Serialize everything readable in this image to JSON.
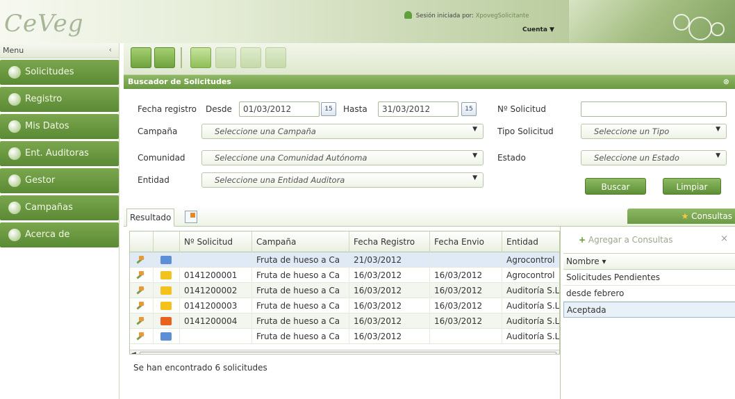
{
  "app": {
    "logo_text": "CeVeg",
    "session_label": "Sesión iniciada por:",
    "session_user": "XpovegSolicitante",
    "account_label": "Cuenta ▼"
  },
  "sidebar": {
    "title": "Menu",
    "collapse": "‹",
    "items": [
      {
        "label": "Solicitudes"
      },
      {
        "label": "Registro"
      },
      {
        "label": "Mis Datos"
      },
      {
        "label": "Ent. Auditoras"
      },
      {
        "label": "Gestor"
      },
      {
        "label": "Campañas"
      },
      {
        "label": "Acerca de"
      }
    ]
  },
  "search": {
    "title": "Buscador de Solicitudes",
    "collapse": "⊗",
    "fecha_registro_label": "Fecha registro",
    "desde_label": "Desde",
    "desde_value": "01/03/2012",
    "hasta_label": "Hasta",
    "hasta_value": "31/03/2012",
    "cal_label": "15",
    "campana_label": "Campaña",
    "campana_placeholder": "Seleccione una Campaña",
    "comunidad_label": "Comunidad",
    "comunidad_placeholder": "Seleccione una Comunidad Autónoma",
    "entidad_label": "Entidad",
    "entidad_placeholder": "Seleccione una Entidad Auditora",
    "nsolicitud_label": "Nº Solicitud",
    "nsolicitud_value": "",
    "tipo_label": "Tipo Solicitud",
    "tipo_placeholder": "Seleccione un Tipo",
    "estado_label": "Estado",
    "estado_placeholder": "Seleccione un Estado",
    "buscar_label": "Buscar",
    "limpiar_label": "Limpiar"
  },
  "results": {
    "tab_label": "Resultado",
    "consultas_tab_label": "Consultas",
    "columns": [
      "Nº Solicitud",
      "Campaña",
      "Fecha Registro",
      "Fecha Envio",
      "Entidad"
    ],
    "rows": [
      {
        "numero": "",
        "campana": "Fruta de hueso a Ca",
        "fecha_registro": "21/03/2012",
        "fecha_envio": "",
        "entidad": "Agrocontrol",
        "folder_color": "#5c8fd6"
      },
      {
        "numero": "0141200001",
        "campana": "Fruta de hueso a Ca",
        "fecha_registro": "16/03/2012",
        "fecha_envio": "16/03/2012",
        "entidad": "Agrocontrol",
        "folder_color": "#f4c21c"
      },
      {
        "numero": "0141200002",
        "campana": "Fruta de hueso a Ca",
        "fecha_registro": "16/03/2012",
        "fecha_envio": "16/03/2012",
        "entidad": "Auditoría S.L",
        "folder_color": "#f4c21c"
      },
      {
        "numero": "0141200003",
        "campana": "Fruta de hueso a Ca",
        "fecha_registro": "16/03/2012",
        "fecha_envio": "16/03/2012",
        "entidad": "Auditoría S.L",
        "folder_color": "#f4c21c"
      },
      {
        "numero": "0141200004",
        "campana": "Fruta de hueso a Ca",
        "fecha_registro": "16/03/2012",
        "fecha_envio": "16/03/2012",
        "entidad": "Auditoría S.L",
        "folder_color": "#e8621d"
      },
      {
        "numero": "",
        "campana": "Fruta de hueso a Ca",
        "fecha_registro": "16/03/2012",
        "fecha_envio": "",
        "entidad": "Auditoría S.L",
        "folder_color": "#5c8fd6"
      }
    ],
    "footer": "Se han encontrado 6 solicitudes",
    "scroll_left": "◄"
  },
  "consultas": {
    "add_label": "Agregar a Consultas",
    "close": "×",
    "header": "Nombre ▾",
    "items": [
      {
        "label": "Solicitudes Pendientes"
      },
      {
        "label": "desde febrero"
      },
      {
        "label": "Aceptada"
      }
    ]
  },
  "colors": {
    "accent_green": "#6c9a43",
    "header_green": "#a7bf86"
  }
}
